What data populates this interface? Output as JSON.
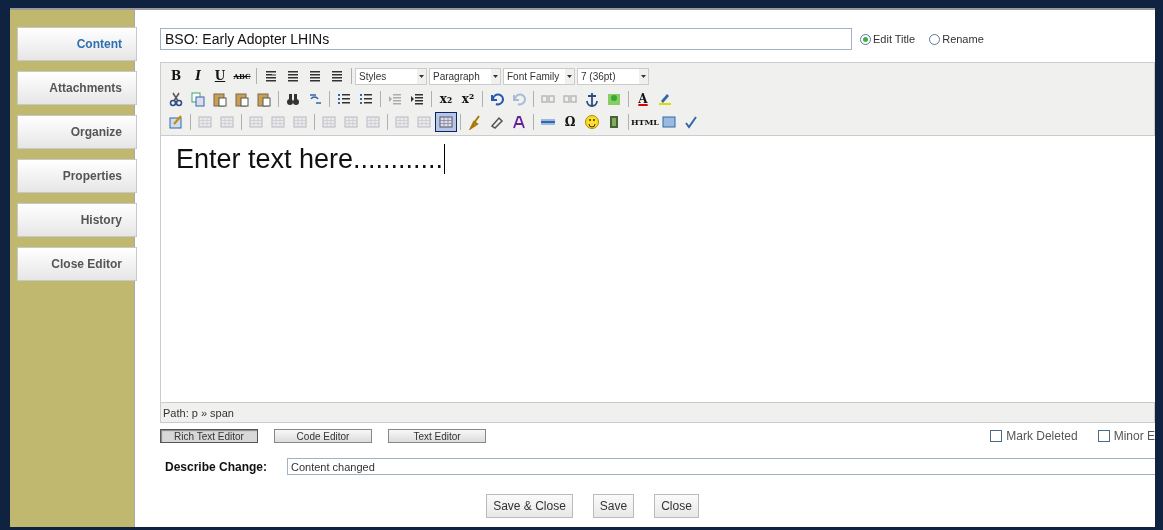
{
  "sidebar": {
    "items": [
      {
        "label": "Content",
        "selected": true
      },
      {
        "label": "Attachments",
        "selected": false
      },
      {
        "label": "Organize",
        "selected": false
      },
      {
        "label": "Properties",
        "selected": false
      },
      {
        "label": "History",
        "selected": false
      },
      {
        "label": "Close Editor",
        "selected": false
      }
    ]
  },
  "title_field": {
    "value": "BSO: Early Adopter LHINs"
  },
  "title_mode": [
    {
      "label": "Edit Title",
      "selected": true
    },
    {
      "label": "Rename",
      "selected": false
    }
  ],
  "toolbar": {
    "rows": [
      [
        {
          "kind": "button",
          "label": "B",
          "disabled": false
        },
        {
          "kind": "button",
          "label": "I",
          "disabled": false
        },
        {
          "kind": "button",
          "label": "U",
          "disabled": false
        },
        {
          "kind": "button",
          "label": "ABC",
          "disabled": false
        },
        {
          "kind": "separator"
        },
        {
          "kind": "button",
          "disabled": false
        },
        {
          "kind": "button",
          "disabled": false
        },
        {
          "kind": "button",
          "disabled": false
        },
        {
          "kind": "button",
          "disabled": false
        },
        {
          "kind": "separator"
        },
        {
          "kind": "dropdown",
          "value": "Styles"
        },
        {
          "kind": "dropdown",
          "value": "Paragraph"
        },
        {
          "kind": "dropdown",
          "value": "Font Family"
        },
        {
          "kind": "dropdown",
          "value": "7 (36pt)"
        }
      ],
      [
        {
          "kind": "button",
          "disabled": false
        },
        {
          "kind": "button",
          "disabled": false
        },
        {
          "kind": "button",
          "disabled": false
        },
        {
          "kind": "button",
          "disabled": false
        },
        {
          "kind": "button",
          "disabled": false
        },
        {
          "kind": "separator"
        },
        {
          "kind": "button",
          "disabled": false
        },
        {
          "kind": "button",
          "disabled": false
        },
        {
          "kind": "separator"
        },
        {
          "kind": "button",
          "disabled": false
        },
        {
          "kind": "button",
          "disabled": false
        },
        {
          "kind": "separator"
        },
        {
          "kind": "button",
          "disabled": true
        },
        {
          "kind": "button",
          "disabled": false
        },
        {
          "kind": "separator"
        },
        {
          "kind": "button",
          "label": "x₂",
          "disabled": false
        },
        {
          "kind": "button",
          "label": "x²",
          "disabled": false
        },
        {
          "kind": "separator"
        },
        {
          "kind": "button",
          "disabled": false
        },
        {
          "kind": "button",
          "disabled": true
        },
        {
          "kind": "separator"
        },
        {
          "kind": "button",
          "disabled": true
        },
        {
          "kind": "button",
          "disabled": true
        },
        {
          "kind": "button",
          "disabled": false
        },
        {
          "kind": "button",
          "disabled": false
        },
        {
          "kind": "separator"
        },
        {
          "kind": "button",
          "label": "A",
          "disabled": false
        },
        {
          "kind": "button",
          "disabled": false
        }
      ],
      [
        {
          "kind": "button",
          "disabled": false
        },
        {
          "kind": "separator"
        },
        {
          "kind": "button",
          "disabled": true
        },
        {
          "kind": "button",
          "disabled": true
        },
        {
          "kind": "separator"
        },
        {
          "kind": "button",
          "disabled": true
        },
        {
          "kind": "button",
          "disabled": true
        },
        {
          "kind": "button",
          "disabled": true
        },
        {
          "kind": "separator"
        },
        {
          "kind": "button",
          "disabled": true
        },
        {
          "kind": "button",
          "disabled": true
        },
        {
          "kind": "button",
          "disabled": true
        },
        {
          "kind": "separator"
        },
        {
          "kind": "button",
          "disabled": true
        },
        {
          "kind": "button",
          "disabled": true
        },
        {
          "kind": "button",
          "disabled": false,
          "selected": true
        },
        {
          "kind": "separator"
        },
        {
          "kind": "button",
          "disabled": false
        },
        {
          "kind": "button",
          "disabled": false
        },
        {
          "kind": "button",
          "disabled": false
        },
        {
          "kind": "separator"
        },
        {
          "kind": "button",
          "disabled": false
        },
        {
          "kind": "button",
          "label": "Ω",
          "disabled": false
        },
        {
          "kind": "button",
          "disabled": false
        },
        {
          "kind": "button",
          "disabled": false
        },
        {
          "kind": "separator"
        },
        {
          "kind": "button",
          "label": "HTML",
          "disabled": false
        },
        {
          "kind": "button",
          "disabled": false
        },
        {
          "kind": "button",
          "disabled": false
        }
      ]
    ]
  },
  "editor": {
    "content": "Enter text here............"
  },
  "path_bar": "Path: p » span",
  "editor_modes": [
    {
      "label": "Rich Text Editor",
      "selected": true
    },
    {
      "label": "Code Editor",
      "selected": false
    },
    {
      "label": "Text Editor",
      "selected": false
    }
  ],
  "options": [
    {
      "label": "Mark Deleted",
      "checked": false
    },
    {
      "label": "Minor E",
      "checked": false
    }
  ],
  "describe_change": {
    "label": "Describe Change:",
    "value": "Content changed"
  },
  "buttons": [
    "Save & Close",
    "Save",
    "Close"
  ]
}
